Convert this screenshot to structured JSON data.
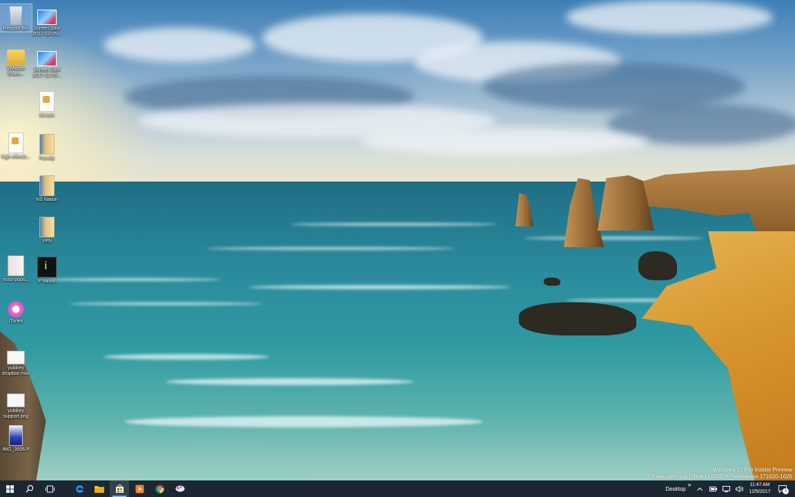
{
  "desktop_icons": [
    {
      "id": "recycle",
      "label": "Recycle Bin",
      "glyph": "recycle-bin-icon",
      "selected": true
    },
    {
      "id": "shot1",
      "label": "Screen Shot 2017-12-05...",
      "glyph": "screenshot-file-icon"
    },
    {
      "id": "vmware",
      "label": "VMware Share...",
      "glyph": "shared-folder-icon"
    },
    {
      "id": "shot2",
      "label": "Screen Shot 2017-12-05...",
      "glyph": "screenshot-file-icon"
    },
    {
      "id": "kircom",
      "label": "Kircom",
      "glyph": "document-icon"
    },
    {
      "id": "high",
      "label": "high effecto...",
      "glyph": "document-icon"
    },
    {
      "id": "parody",
      "label": "Parody",
      "glyph": "archive-icon"
    },
    {
      "id": "nation",
      "label": "NS Nation",
      "glyph": "archive-icon"
    },
    {
      "id": "vpn",
      "label": "VPN",
      "glyph": "archive-icon"
    },
    {
      "id": "most",
      "label": "most-popu...",
      "glyph": "book-icon"
    },
    {
      "id": "ipvanish",
      "label": "IPVanish",
      "glyph": "ipvanish-icon"
    },
    {
      "id": "itunes",
      "label": "iTunes",
      "glyph": "itunes-icon"
    },
    {
      "id": "yubimov",
      "label": "yubikey dropbox.mov",
      "glyph": "video-file-icon"
    },
    {
      "id": "yubipng",
      "label": "yubikey support.png",
      "glyph": "image-file-icon"
    },
    {
      "id": "img3506",
      "label": "IMG_3506.P",
      "glyph": "image-file-icon"
    }
  ],
  "watermark": {
    "line1": "Windows 10 Pro Insider Preview",
    "line2": "Evaluation copy. Build 17025.rs_prerelease.171020-1626"
  },
  "taskbar": {
    "pinned": [
      {
        "name": "start-button",
        "icon": "windows-logo-icon"
      },
      {
        "name": "search-button",
        "icon": "search-icon"
      },
      {
        "name": "task-view-button",
        "icon": "task-view-icon"
      },
      {
        "name": "edge-button",
        "icon": "edge-icon"
      },
      {
        "name": "file-explorer-button",
        "icon": "folder-icon"
      },
      {
        "name": "store-button",
        "icon": "store-icon",
        "active": true
      },
      {
        "name": "media-button",
        "icon": "media-player-icon"
      },
      {
        "name": "chrome-button",
        "icon": "chrome-icon"
      },
      {
        "name": "app-button",
        "icon": "app-icon"
      }
    ],
    "toolbar_label": "Desktop",
    "toolbar_chevron": "»",
    "time": "11:47 AM",
    "date": "12/5/2017",
    "notification_count": "1"
  },
  "colors": {
    "taskbar_bg": "#1b2733",
    "accent": "#76b9ed"
  }
}
